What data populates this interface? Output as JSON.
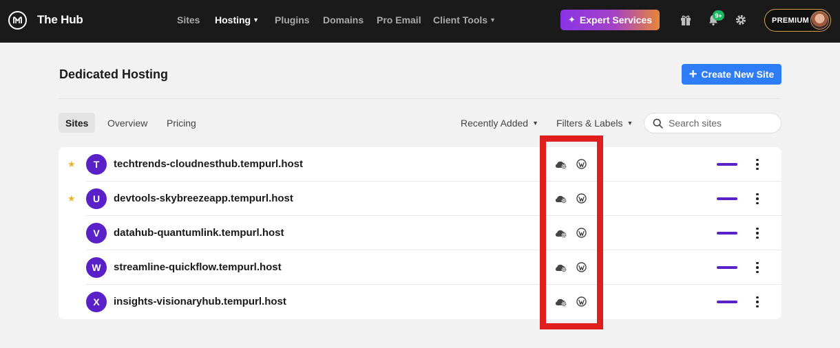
{
  "app": {
    "title": "The Hub"
  },
  "nav": {
    "items": [
      {
        "label": "Sites",
        "active": false,
        "dropdown": false
      },
      {
        "label": "Hosting",
        "active": true,
        "dropdown": true
      },
      {
        "label": "Plugins",
        "active": false,
        "dropdown": false
      },
      {
        "label": "Domains",
        "active": false,
        "dropdown": false
      },
      {
        "label": "Pro Email",
        "active": false,
        "dropdown": false
      },
      {
        "label": "Client Tools",
        "active": false,
        "dropdown": true
      }
    ],
    "expert_label": "Expert Services",
    "notification_badge": "9+",
    "account_label": "PREMIUM"
  },
  "page": {
    "title": "Dedicated Hosting",
    "create_label": "Create New Site"
  },
  "tabs": [
    {
      "label": "Sites",
      "active": true
    },
    {
      "label": "Overview",
      "active": false
    },
    {
      "label": "Pricing",
      "active": false
    }
  ],
  "controls": {
    "sort_label": "Recently Added",
    "filter_label": "Filters & Labels",
    "search_placeholder": "Search sites"
  },
  "sites": [
    {
      "letter": "T",
      "name": "techtrends-cloudnesthub.tempurl.host",
      "starred": true
    },
    {
      "letter": "U",
      "name": "devtools-skybreezeapp.tempurl.host",
      "starred": true
    },
    {
      "letter": "V",
      "name": "datahub-quantumlink.tempurl.host",
      "starred": false
    },
    {
      "letter": "W",
      "name": "streamline-quickflow.tempurl.host",
      "starred": false
    },
    {
      "letter": "X",
      "name": "insights-visionaryhub.tempurl.host",
      "starred": false
    }
  ],
  "colors": {
    "topbar": "#1a1a1a",
    "accent_blue": "#2e7cf6",
    "site_avatar": "#5b21c9",
    "star": "#f0b429",
    "highlight": "#e01e1e"
  },
  "icons": {
    "row_icons": [
      "cloud-settings-icon",
      "wordpress-icon"
    ]
  }
}
